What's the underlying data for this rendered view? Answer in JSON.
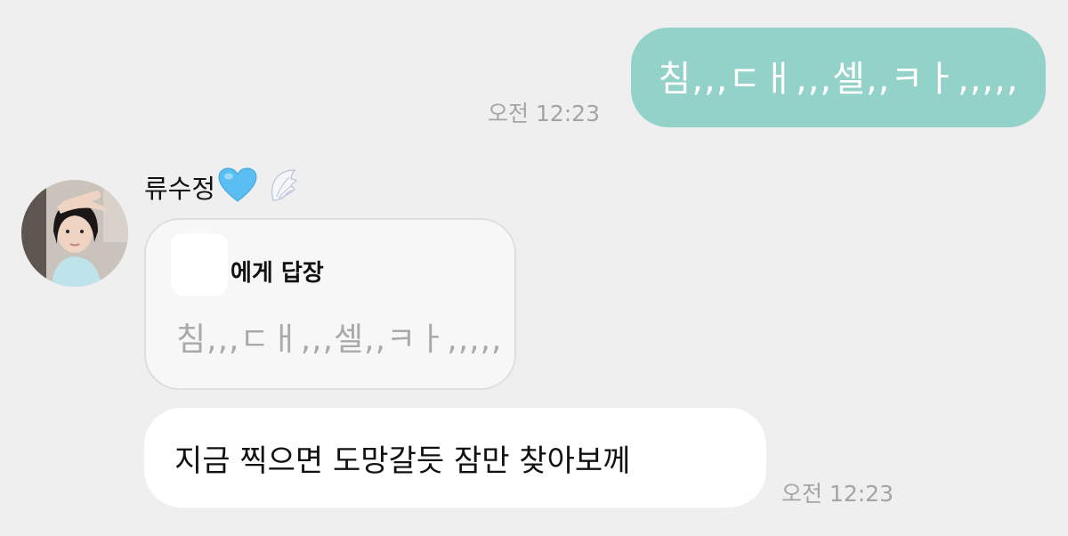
{
  "chat": {
    "sent_message": {
      "text": "침,,,ㄷㅐ,,,셀,,ㅋㅏ,,,,,",
      "time": "오전 12:23"
    },
    "received": {
      "sender_name": "류수정",
      "sender_emojis": [
        "light-blue-heart-icon",
        "wing-icon"
      ],
      "reply_label": "에게 답장",
      "quoted_text": "침,,,ㄷㅐ,,,셀,,ㅋㅏ,,,,,",
      "message_text": "지금 찍으면 도망갈듯 잠만 찾아보께",
      "time": "오전 12:23"
    }
  },
  "colors": {
    "background": "#efefef",
    "sent_bubble": "#93d2c9",
    "received_bubble": "#ffffff",
    "reply_bubble": "#f7f7f7",
    "timestamp": "#a4a4a4",
    "quoted_text": "#a9a9a9"
  }
}
